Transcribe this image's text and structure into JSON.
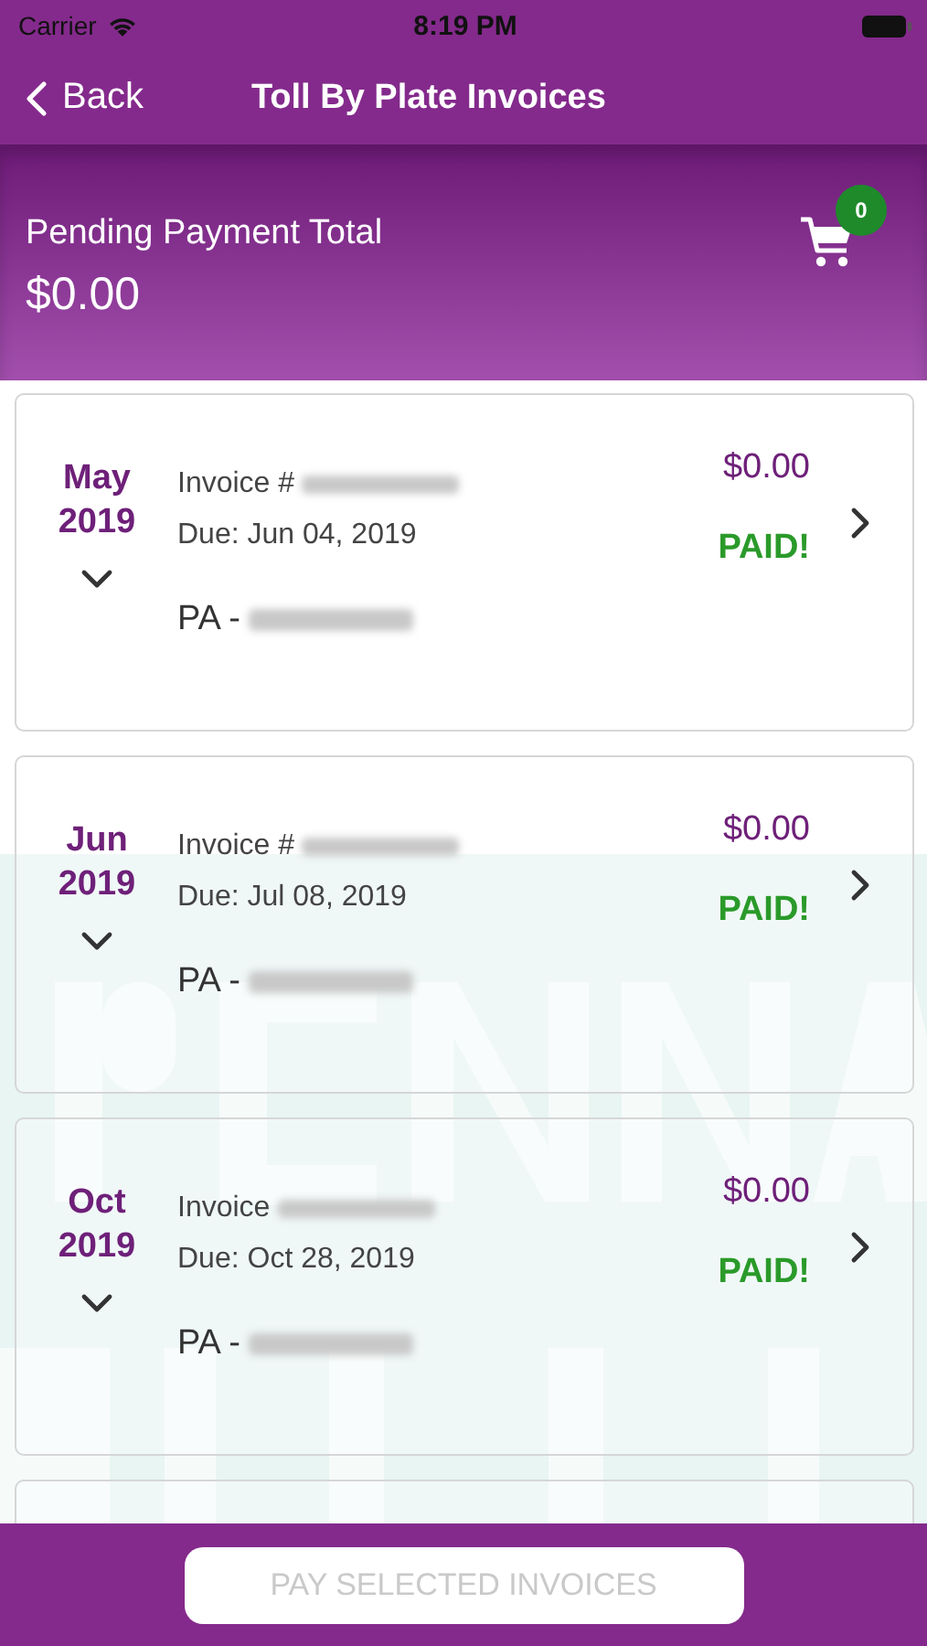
{
  "status_bar": {
    "carrier": "Carrier",
    "time": "8:19 PM"
  },
  "nav": {
    "back": "Back",
    "title": "Toll By Plate Invoices"
  },
  "summary": {
    "label": "Pending Payment Total",
    "total": "$0.00",
    "cart_count": "0"
  },
  "invoices": [
    {
      "month": "May",
      "year": "2019",
      "invoice_label": "Invoice #",
      "due": "Due: Jun 04, 2019",
      "plate": "PA -",
      "amount": "$0.00",
      "status": "PAID!"
    },
    {
      "month": "Jun",
      "year": "2019",
      "invoice_label": "Invoice #",
      "due": "Due: Jul 08, 2019",
      "plate": "PA -",
      "amount": "$0.00",
      "status": "PAID!"
    },
    {
      "month": "Oct",
      "year": "2019",
      "invoice_label": "Invoice",
      "due": "Due: Oct 28, 2019",
      "plate": "PA -",
      "amount": "$0.00",
      "status": "PAID!"
    }
  ],
  "more_cards_below": true,
  "pay_button": {
    "label": "PAY SELECTED INVOICES",
    "disabled": true
  }
}
